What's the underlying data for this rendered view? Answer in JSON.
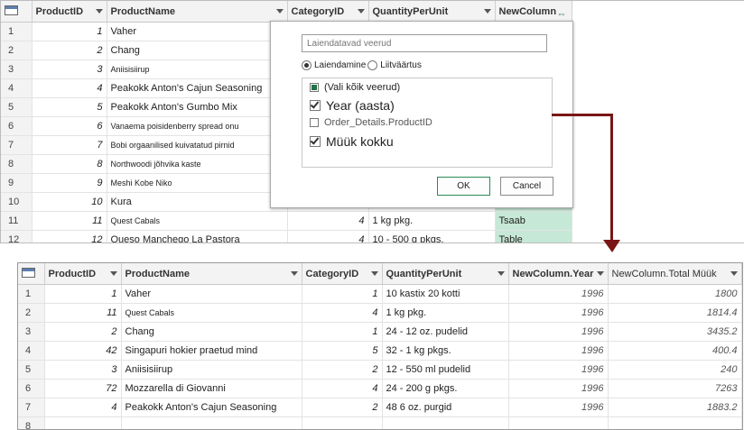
{
  "top": {
    "headers": [
      "ProductID",
      "ProductName",
      "CategoryID",
      "QuantityPerUnit",
      "NewColumn"
    ],
    "rows": [
      {
        "rn": "1",
        "id": "1",
        "name": "Vaher",
        "cat": "",
        "qty": "",
        "nc": ""
      },
      {
        "rn": "2",
        "id": "2",
        "name": "Chang",
        "cat": "",
        "qty": "",
        "nc": ""
      },
      {
        "rn": "3",
        "id": "3",
        "name": "Aniisisiirup",
        "cat": "",
        "qty": "",
        "nc": ""
      },
      {
        "rn": "4",
        "id": "4",
        "name": "Peakokk Anton's Cajun Seasoning",
        "cat": "",
        "qty": "",
        "nc": ""
      },
      {
        "rn": "5",
        "id": "5",
        "name": "Peakokk Anton's Gumbo Mix",
        "cat": "",
        "qty": "",
        "nc": ""
      },
      {
        "rn": "6",
        "id": "6",
        "name": "Vanaema poisidenberry spread onu",
        "cat": "",
        "qty": "",
        "nc": ""
      },
      {
        "rn": "7",
        "id": "7",
        "name": "Bobi orgaanilised kuivatatud pirnid",
        "cat": "",
        "qty": "",
        "nc": ""
      },
      {
        "rn": "8",
        "id": "8",
        "name": "Northwoodi jõhvika kaste",
        "cat": "",
        "qty": "",
        "nc": ""
      },
      {
        "rn": "9",
        "id": "9",
        "name": "Meshi Kobe Niko",
        "cat": "",
        "qty": "",
        "nc": ""
      },
      {
        "rn": "10",
        "id": "10",
        "name": "Kura",
        "cat": "",
        "qty": "",
        "nc": ""
      },
      {
        "rn": "11",
        "id": "11",
        "name": "Quest Cabals",
        "cat": "4",
        "qty": "1 kg pkg.",
        "nc": "Tsaab"
      },
      {
        "rn": "12",
        "id": "12",
        "name": "Queso Manchego La Pastora",
        "cat": "4",
        "qty": "10 - 500 g pkgs.",
        "nc": "Table"
      }
    ]
  },
  "dialog": {
    "search_placeholder": "Laiendatavad veerud",
    "radio_expand": "Laiendamine",
    "radio_aggregate": "Liitväärtus",
    "select_all": "(Vali kõik veerud)",
    "columns": [
      "Year (aasta)",
      "Order_Details.ProductID",
      "Müük kokku"
    ],
    "ok": "OK",
    "cancel": "Cancel"
  },
  "bottom": {
    "headers": [
      "ProductID",
      "ProductName",
      "CategoryID",
      "QuantityPerUnit",
      "NewColumn.Year",
      "NewColumn.Total Müük"
    ],
    "rows": [
      {
        "rn": "1",
        "id": "1",
        "name": "Vaher",
        "cat": "1",
        "qty": "10 kastix 20 kotti",
        "year": "1996",
        "total": "1800"
      },
      {
        "rn": "2",
        "id": "11",
        "name": "Quest Cabals",
        "cat": "4",
        "qty": "1 kg pkg.",
        "year": "1996",
        "total": "1814.4"
      },
      {
        "rn": "3",
        "id": "2",
        "name": "Chang",
        "cat": "1",
        "qty": "24 - 12 oz. pudelid",
        "year": "1996",
        "total": "3435.2"
      },
      {
        "rn": "4",
        "id": "42",
        "name": "Singapuri hokier praetud mind",
        "cat": "5",
        "qty": "32 - 1 kg pkgs.",
        "year": "1996",
        "total": "400.4"
      },
      {
        "rn": "5",
        "id": "3",
        "name": "Aniisisiirup",
        "cat": "2",
        "qty": "12 - 550 ml pudelid",
        "year": "1996",
        "total": "240"
      },
      {
        "rn": "6",
        "id": "72",
        "name": "Mozzarella di Giovanni",
        "cat": "4",
        "qty": "24 - 200 g pkgs.",
        "year": "1996",
        "total": "7263"
      },
      {
        "rn": "7",
        "id": "4",
        "name": "Peakokk Anton's Cajun Seasoning",
        "cat": "2",
        "qty": "48 6 oz. purgid",
        "year": "1996",
        "total": "1883.2"
      },
      {
        "rn": "8",
        "id": "",
        "name": "",
        "cat": "",
        "qty": "",
        "year": "",
        "total": ""
      }
    ]
  }
}
